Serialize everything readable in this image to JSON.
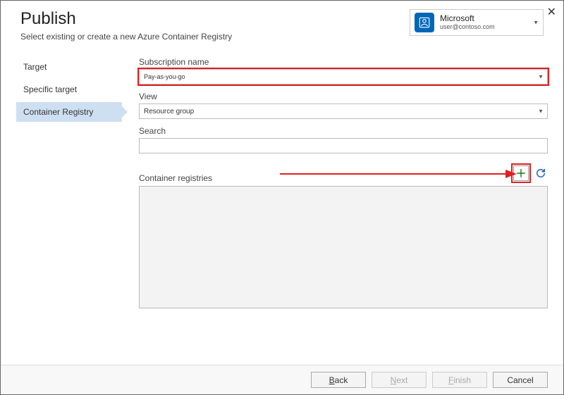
{
  "header": {
    "title": "Publish",
    "subtitle": "Select existing or create a new Azure Container Registry"
  },
  "account": {
    "name": "Microsoft",
    "email": "user@contoso.com"
  },
  "nav": {
    "items": [
      {
        "label": "Target"
      },
      {
        "label": "Specific target"
      },
      {
        "label": "Container Registry"
      }
    ]
  },
  "form": {
    "subscription_label": "Subscription name",
    "subscription_value": "Pay-as-you-go",
    "view_label": "View",
    "view_value": "Resource group",
    "search_label": "Search",
    "search_value": "",
    "registries_label": "Container registries"
  },
  "footer": {
    "back": "Back",
    "next": "Next",
    "finish": "Finish",
    "cancel": "Cancel"
  }
}
